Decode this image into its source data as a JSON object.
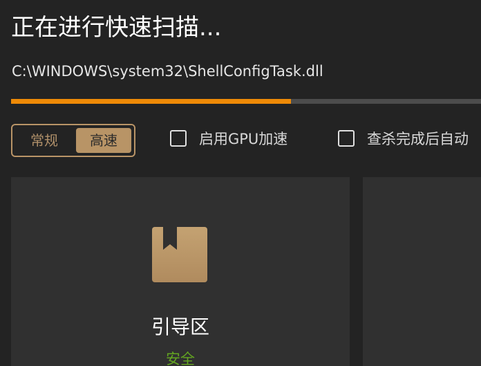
{
  "header": {
    "title": "正在进行快速扫描...",
    "current_file": "C:\\WINDOWS\\system32\\ShellConfigTask.dll"
  },
  "progress": {
    "fraction": 0.595,
    "fill_color": "#ee8a07",
    "track_color": "#4c4c4c"
  },
  "mode_toggle": {
    "normal_label": "常规",
    "fast_label": "高速",
    "selected": "fast",
    "accent_color": "#b89466"
  },
  "options": {
    "gpu_label": "启用GPU加速",
    "gpu_checked": false,
    "auto_label": "查杀完成后自动",
    "auto_checked": false
  },
  "cards": [
    {
      "icon": "bookmark-box-icon",
      "title": "引导区",
      "status": "安全",
      "status_color": "#63a521"
    }
  ]
}
